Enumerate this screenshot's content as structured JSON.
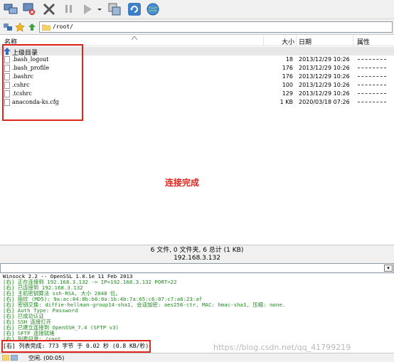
{
  "toolbar": {
    "buttons": [
      {
        "name": "connect-icon"
      },
      {
        "name": "disconnect-icon"
      },
      {
        "name": "abort-icon"
      },
      {
        "name": "pause-icon"
      },
      {
        "name": "run-icon"
      },
      {
        "name": "dropdown-arrow-icon"
      },
      {
        "name": "transfer-icon"
      },
      {
        "name": "refresh-icon"
      },
      {
        "name": "globe-icon"
      }
    ]
  },
  "address": {
    "path": "/root/"
  },
  "columns": {
    "name": "名称",
    "size": "大小",
    "date": "日期",
    "perm": "属性"
  },
  "up_row": {
    "label": "上级目录"
  },
  "files": [
    {
      "name": ".bash_logout",
      "size": "18",
      "date": "2013/12/29  10:26"
    },
    {
      "name": ".bash_profile",
      "size": "176",
      "date": "2013/12/29  10:26"
    },
    {
      "name": ".bashrc",
      "size": "176",
      "date": "2013/12/29  10:26"
    },
    {
      "name": ".cshrc",
      "size": "100",
      "date": "2013/12/29  10:26"
    },
    {
      "name": ".tcshrc",
      "size": "129",
      "date": "2013/12/29  10:26"
    },
    {
      "name": "anaconda-ks.cfg",
      "size": "1 KB",
      "date": "2020/03/18  07:26"
    }
  ],
  "center_message": "连接完成",
  "status": {
    "summary": "6 文件, 0 文件夹, 6 总计 (1 KB)",
    "host": "192.168.3.132"
  },
  "log": [
    {
      "text": "Winsock 2.2 -- OpenSSL 1.0.1e 11 Feb 2013",
      "color": "black"
    },
    {
      "text": "[右] 正在连接到 192.168.3.132 -> IP=192.168.3.132 PORT=22",
      "color": "green"
    },
    {
      "text": "[右] 已连接到 192.168.3.132",
      "color": "green"
    },
    {
      "text": "[右] 主机密钥算法 ssh-RSA, 大小 2048 位。",
      "color": "green"
    },
    {
      "text": "[右] 指纹 (MD5): 9a:ac:84:8b:b6:0a:1b:4b:7a:65:c6:07:c7:a6:23:af",
      "color": "green"
    },
    {
      "text": "[右] 密钥交换: diffie-hellman-group14-sha1, 会话加密: aes256-ctr, MAC: hmac-sha1, 压缩: none.",
      "color": "green"
    },
    {
      "text": "[右] Auth Type: Password",
      "color": "green"
    },
    {
      "text": "[右] 已成功认证",
      "color": "green"
    },
    {
      "text": "[右] SSH 连接打开",
      "color": "green"
    },
    {
      "text": "[右] 已建立连接到 OpenSSH_7.4 (SFTP v3)",
      "color": "green"
    },
    {
      "text": "[右] SFTP 连接就绪",
      "color": "green"
    },
    {
      "text": "[右] 列表目录: /root",
      "color": "green"
    },
    {
      "text": "[右] 列表完成: 773 字节 于 0.02 秒 (0.8 KB/秒)",
      "color": "black"
    }
  ],
  "watermark": "https://blog.csdn.net/qq_41799219",
  "bottom": {
    "idle": "空闲. (00:05)"
  },
  "colors": {
    "highlight": "#e0241b",
    "log_green": "#1f8a1f"
  }
}
